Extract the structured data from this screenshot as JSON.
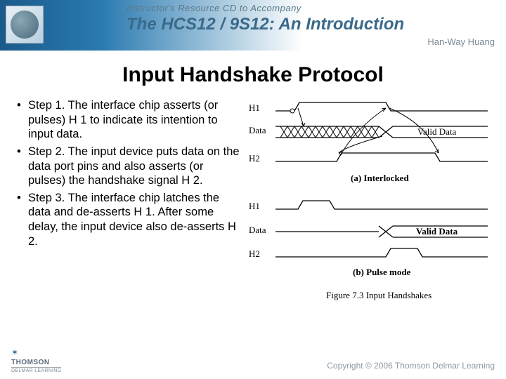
{
  "header": {
    "resource_line": "Instructor's Resource CD to Accompany",
    "title": "The HCS12 / 9S12: An Introduction",
    "author": "Han-Way Huang"
  },
  "slide": {
    "title": "Input Handshake Protocol"
  },
  "steps": [
    "Step 1. The interface chip asserts (or pulses) H 1 to indicate its intention to input data.",
    "Step 2. The input device puts data on the data port pins and also asserts (or pulses) the handshake signal H 2.",
    "Step 3. The interface chip latches the data and de-asserts H 1. After some delay, the input device also de-asserts H 2."
  ],
  "diagram": {
    "signals_a": {
      "h1": "H1",
      "data": "Data",
      "h2": "H2"
    },
    "valid_data": "Valid Data",
    "caption_a": "(a) Interlocked",
    "signals_b": {
      "h1": "H1",
      "data": "Data",
      "h2": "H2"
    },
    "caption_b": "(b) Pulse mode",
    "figure_caption": "Figure 7.3 Input Handshakes"
  },
  "footer": {
    "thomson": "THOMSON",
    "delmar": "DELMAR LEARNING",
    "copyright": "Copyright © 2006 Thomson Delmar Learning"
  }
}
